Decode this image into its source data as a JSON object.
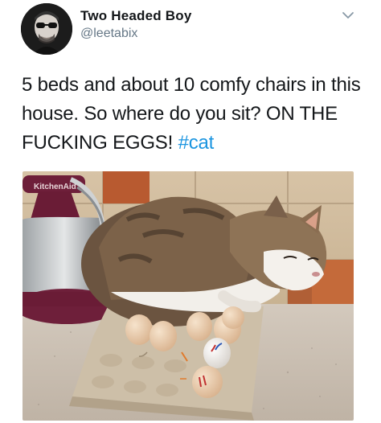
{
  "author": {
    "display_name": "Two Headed Boy",
    "handle": "@leetabix",
    "avatar_icon": "profile-photo",
    "menu_icon": "chevron-down-icon"
  },
  "tweet": {
    "text_before_hashtag": "5 beds and about 10 comfy chairs in this house. So where do you sit? ON THE FUCKING EGGS! ",
    "hashtag": "#cat"
  },
  "photo": {
    "subject": "cat-sitting-on-egg-carton",
    "mixer_brand_mark": "KitchenAid"
  },
  "colors": {
    "text": "#14171a",
    "secondary": "#657786",
    "link": "#1b95e0",
    "mixer": "#6e1f3a"
  }
}
